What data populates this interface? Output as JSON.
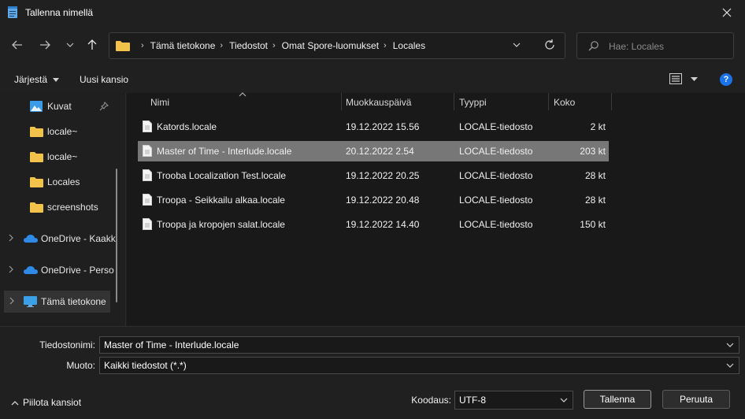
{
  "window": {
    "title": "Tallenna nimellä",
    "close_icon": "close-icon"
  },
  "navigation": {
    "back_icon": "back-arrow-icon",
    "forward_icon": "forward-arrow-icon",
    "recent_icon": "chevron-down-icon",
    "up_icon": "up-arrow-icon",
    "breadcrumbs": [
      "Tämä tietokone",
      "Tiedostot",
      "Omat Spore-luomukset",
      "Locales"
    ],
    "search_placeholder": "Hae: Locales"
  },
  "toolbar": {
    "organize_label": "Järjestä",
    "new_folder_label": "Uusi kansio"
  },
  "sidebar": {
    "items": [
      {
        "label": "Kuvat",
        "icon": "pictures-icon",
        "pinned": true
      },
      {
        "label": "locale~",
        "icon": "folder-icon"
      },
      {
        "label": "locale~",
        "icon": "folder-icon"
      },
      {
        "label": "Locales",
        "icon": "folder-icon"
      },
      {
        "label": "screenshots",
        "icon": "folder-icon"
      },
      {
        "label": "OneDrive - Kaakk",
        "icon": "onedrive-icon",
        "expandable": true
      },
      {
        "label": "OneDrive - Perso",
        "icon": "onedrive-icon",
        "expandable": true
      },
      {
        "label": "Tämä tietokone",
        "icon": "computer-icon",
        "expandable": true,
        "selected": true
      }
    ]
  },
  "filelist": {
    "columns": [
      "Nimi",
      "Muokkauspäivä",
      "Tyyppi",
      "Koko"
    ],
    "rows": [
      {
        "name": "Katords.locale",
        "modified": "19.12.2022 15.56",
        "type": "LOCALE-tiedosto",
        "size": "2 kt"
      },
      {
        "name": "Master of Time - Interlude.locale",
        "modified": "20.12.2022 2.54",
        "type": "LOCALE-tiedosto",
        "size": "203 kt",
        "selected": true
      },
      {
        "name": "Trooba Localization Test.locale",
        "modified": "19.12.2022 20.25",
        "type": "LOCALE-tiedosto",
        "size": "28 kt"
      },
      {
        "name": "Troopa - Seikkailu alkaa.locale",
        "modified": "19.12.2022 20.48",
        "type": "LOCALE-tiedosto",
        "size": "28 kt"
      },
      {
        "name": "Troopa ja kropojen salat.locale",
        "modified": "19.12.2022 14.40",
        "type": "LOCALE-tiedosto",
        "size": "150 kt"
      }
    ]
  },
  "footer": {
    "filename_label": "Tiedostonimi:",
    "filename_value": "Master of Time - Interlude.locale",
    "format_label": "Muoto:",
    "format_value": "Kaikki tiedostot  (*.*)",
    "encoding_label": "Koodaus:",
    "encoding_value": "UTF-8",
    "save_label": "Tallenna",
    "cancel_label": "Peruuta",
    "hide_folders_label": "Piilota kansiot"
  },
  "colors": {
    "accent": "#1a73e8",
    "folder": "#f2c24a",
    "selected_row": "#777777"
  }
}
